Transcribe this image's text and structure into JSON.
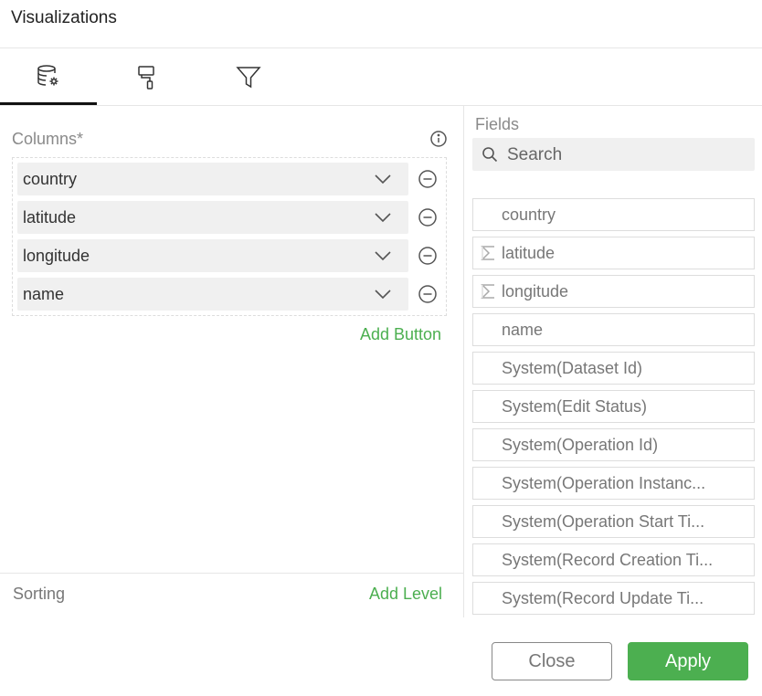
{
  "header": {
    "title": "Visualizations"
  },
  "tabs": [
    {
      "icon": "database-settings-icon"
    },
    {
      "icon": "paint-roller-icon"
    },
    {
      "icon": "filter-icon"
    }
  ],
  "columns": {
    "label": "Columns*",
    "items": [
      {
        "label": "country"
      },
      {
        "label": "latitude"
      },
      {
        "label": "longitude"
      },
      {
        "label": "name"
      }
    ],
    "add_button": "Add Button"
  },
  "sorting": {
    "label": "Sorting",
    "add_level": "Add Level"
  },
  "fields": {
    "label": "Fields",
    "search_placeholder": "Search",
    "items": [
      {
        "label": "country",
        "measure": false
      },
      {
        "label": "latitude",
        "measure": true
      },
      {
        "label": "longitude",
        "measure": true
      },
      {
        "label": "name",
        "measure": false
      },
      {
        "label": "System(Dataset Id)",
        "measure": false
      },
      {
        "label": "System(Edit Status)",
        "measure": false
      },
      {
        "label": "System(Operation Id)",
        "measure": false
      },
      {
        "label": "System(Operation Instanc...",
        "measure": false
      },
      {
        "label": "System(Operation Start Ti...",
        "measure": false
      },
      {
        "label": "System(Record Creation Ti...",
        "measure": false
      },
      {
        "label": "System(Record Update Ti...",
        "measure": false
      }
    ]
  },
  "footer": {
    "close_label": "Close",
    "apply_label": "Apply"
  },
  "colors": {
    "accent": "#4caf50",
    "active_tab_border": "#111111"
  }
}
